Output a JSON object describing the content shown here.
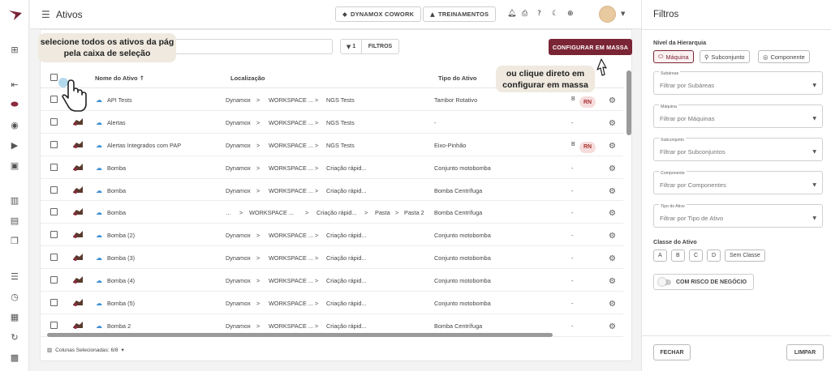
{
  "topbar": {
    "title": "Ativos",
    "btn_cowork": "DYNAMOX COWORK",
    "btn_treinamentos": "TREINAMENTOS"
  },
  "toolbar": {
    "filter_count": "1",
    "filter_label": "FILTROS",
    "config_label": "CONFIGURAR EM MASSA"
  },
  "table": {
    "headers": {
      "name": "Nome do Ativo",
      "location": "Localização",
      "type": "Tipo do Ativo"
    },
    "rows": [
      {
        "name": "API Tests",
        "loc": [
          "Dynamox",
          ">",
          "WORKSPACE ...",
          ">",
          "NGS Tests"
        ],
        "type": "Tambor Rotativo",
        "cls": "B",
        "rn": "RN"
      },
      {
        "name": "Alertas",
        "loc": [
          "Dynamox",
          ">",
          "WORKSPACE ...",
          ">",
          "NGS Tests"
        ],
        "type": "-",
        "cls": "-",
        "rn": ""
      },
      {
        "name": "Alertas Integrados com PAP",
        "loc": [
          "Dynamox",
          ">",
          "WORKSPACE ...",
          ">",
          "NGS Tests"
        ],
        "type": "Eixo-Pinhão",
        "cls": "B",
        "rn": "RN"
      },
      {
        "name": "Bomba",
        "loc": [
          "Dynamox",
          ">",
          "WORKSPACE ...",
          ">",
          "Criação rápid..."
        ],
        "type": "Conjunto motobomba",
        "cls": "-",
        "rn": ""
      },
      {
        "name": "Bomba",
        "loc": [
          "Dynamox",
          ">",
          "WORKSPACE ...",
          ">",
          "Criação rápid..."
        ],
        "type": "Bomba Centrífuga",
        "cls": "-",
        "rn": ""
      },
      {
        "name": "Bomba",
        "loc": [
          "…",
          ">",
          "WORKSPACE ...",
          ">",
          "Criação rápid...",
          ">",
          "Pasta",
          ">",
          "Pasta 2"
        ],
        "type": "Bomba Centrífuga",
        "cls": "-",
        "rn": ""
      },
      {
        "name": "Bomba (2)",
        "loc": [
          "Dynamox",
          ">",
          "WORKSPACE ...",
          ">",
          "Criação rápid..."
        ],
        "type": "Conjunto motobomba",
        "cls": "-",
        "rn": ""
      },
      {
        "name": "Bomba (3)",
        "loc": [
          "Dynamox",
          ">",
          "WORKSPACE ...",
          ">",
          "Criação rápid..."
        ],
        "type": "Conjunto motobomba",
        "cls": "-",
        "rn": ""
      },
      {
        "name": "Bomba (4)",
        "loc": [
          "Dynamox",
          ">",
          "WORKSPACE ...",
          ">",
          "Criação rápid..."
        ],
        "type": "Conjunto motobomba",
        "cls": "-",
        "rn": ""
      },
      {
        "name": "Bomba (5)",
        "loc": [
          "Dynamox",
          ">",
          "WORKSPACE ...",
          ">",
          "Criação rápid..."
        ],
        "type": "Conjunto motobomba",
        "cls": "-",
        "rn": ""
      },
      {
        "name": "Bomba 2",
        "loc": [
          "Dynamox",
          ">",
          "WORKSPACE ...",
          ">",
          "Criação rápid..."
        ],
        "type": "Bomba Centrífuga",
        "cls": "-",
        "rn": ""
      }
    ],
    "footer": "Colunas Selecionadas: 6/8"
  },
  "tooltips": {
    "select_all": "selecione todos os ativos da pág pela caixa de seleção",
    "configure": "ou clique direto em configurar em massa"
  },
  "filters": {
    "title": "Filtros",
    "hierarchy_label": "Nível da Hierarquia",
    "chips": [
      "Máquina",
      "Subconjunto",
      "Componente"
    ],
    "fields": [
      {
        "caption": "Subáreas",
        "placeholder": "Filtrar por Subáreas"
      },
      {
        "caption": "Máquina",
        "placeholder": "Filtrar por Máquinas"
      },
      {
        "caption": "Subconjunto",
        "placeholder": "Filtrar por Subconjuntos"
      },
      {
        "caption": "Componente",
        "placeholder": "Filtrar por Componentes"
      },
      {
        "caption": "Tipo do Ativo",
        "placeholder": "Filtrar por Tipo de Ativo"
      }
    ],
    "class_label": "Classe do Ativo",
    "classes": [
      "A",
      "B",
      "C",
      "D",
      "Sem Classe"
    ],
    "risk_toggle": "COM RISCO DE NEGÓCIO",
    "close": "FECHAR",
    "clear": "LIMPAR"
  },
  "colors": {
    "accent": "#7a2535",
    "tooltip_bg": "#efe9df",
    "link_icon": "#3b8fd4"
  },
  "icons": [
    "logo-icon",
    "hierarchy-icon",
    "asset-icon",
    "target-icon",
    "play-icon",
    "device-icon",
    "chart-icon",
    "report-icon",
    "copy-icon",
    "list-icon",
    "timer-icon",
    "doc-icon",
    "sync-icon",
    "building-icon",
    "bell-icon",
    "print-icon",
    "help-icon",
    "moon-icon",
    "globe-icon",
    "gear-icon",
    "cloud-icon"
  ]
}
